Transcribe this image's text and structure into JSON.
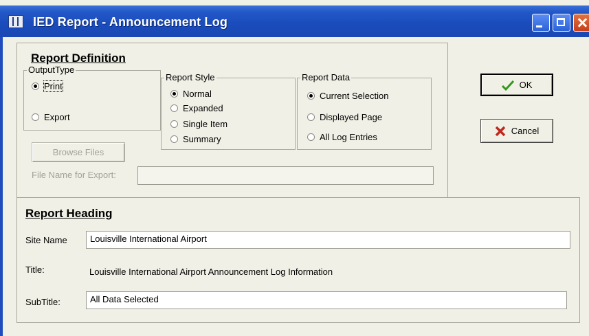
{
  "window": {
    "title": "IED Report - Announcement Log"
  },
  "report_definition": {
    "heading": "Report Definition",
    "output_type": {
      "label": "OutputType",
      "options": [
        {
          "label": "Print",
          "selected": true
        },
        {
          "label": "Export",
          "selected": false
        }
      ]
    },
    "report_style": {
      "label": "Report Style",
      "options": [
        {
          "label": "Normal",
          "selected": true
        },
        {
          "label": "Expanded",
          "selected": false
        },
        {
          "label": "Single Item",
          "selected": false
        },
        {
          "label": "Summary",
          "selected": false
        }
      ]
    },
    "report_data": {
      "label": "Report Data",
      "options": [
        {
          "label": "Current Selection",
          "selected": true
        },
        {
          "label": "Displayed Page",
          "selected": false
        },
        {
          "label": "All Log Entries",
          "selected": false
        }
      ]
    },
    "browse_button": "Browse Files",
    "file_name_label": "File Name for Export:",
    "file_name_value": ""
  },
  "buttons": {
    "ok": "OK",
    "cancel": "Cancel"
  },
  "report_heading": {
    "heading": "Report Heading",
    "site_name_label": "Site Name",
    "site_name_value": "Louisville International Airport",
    "title_label": "Title:",
    "title_value": "Louisville International Airport Announcement Log Information",
    "subtitle_label": "SubTitle:",
    "subtitle_value": "All Data Selected"
  },
  "colors": {
    "titlebar": "#1b4cbc",
    "dialog_bg": "#f1f0e6",
    "ok_check": "#2f9a1a",
    "cancel_x": "#c0281c"
  },
  "icons": [
    "app-icon",
    "minimize-icon",
    "maximize-icon",
    "close-icon",
    "check-icon",
    "x-icon"
  ]
}
